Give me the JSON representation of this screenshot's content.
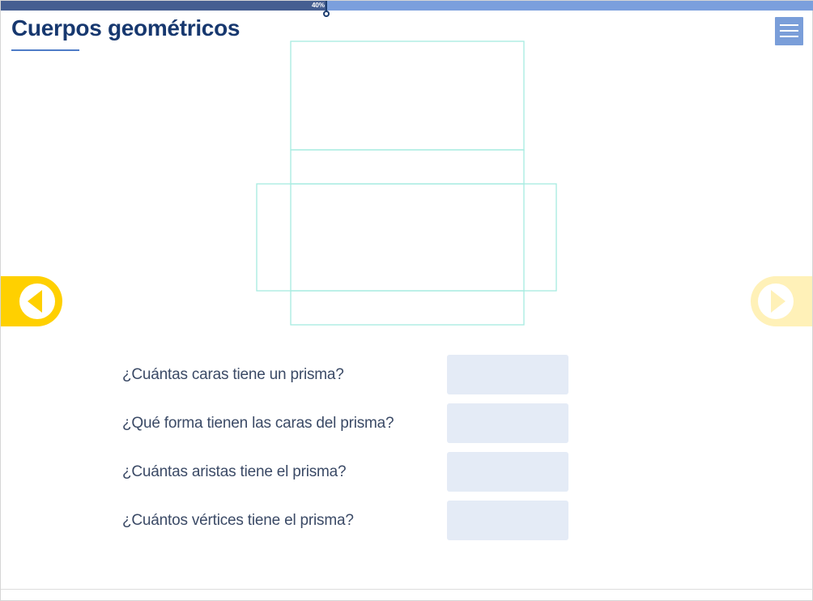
{
  "header": {
    "title": "Cuerpos geométricos",
    "menu_icon": "hamburger-menu-icon"
  },
  "progress": {
    "value_percent": 40,
    "label": "40%"
  },
  "colors": {
    "title": "#17386f",
    "progress_fill": "#455e91",
    "progress_track": "#7b9fdd",
    "menu_button": "#7a9ed9",
    "net_lines": "#a6ece0",
    "nav_active": "#ffd000",
    "nav_inactive": "#fff1b8",
    "input_bg": "#e4ebf6"
  },
  "navigation": {
    "prev_icon": "arrow-left-circle-icon",
    "next_icon": "arrow-right-circle-icon",
    "prev_enabled": true,
    "next_enabled": false
  },
  "questions": [
    {
      "label": "¿Cuántas caras tiene un prisma?",
      "value": ""
    },
    {
      "label": "¿Qué forma tienen las caras del prisma?",
      "value": ""
    },
    {
      "label": "¿Cuántas aristas tiene el prisma?",
      "value": ""
    },
    {
      "label": "¿Cuántos vértices tiene el prisma?",
      "value": ""
    }
  ]
}
